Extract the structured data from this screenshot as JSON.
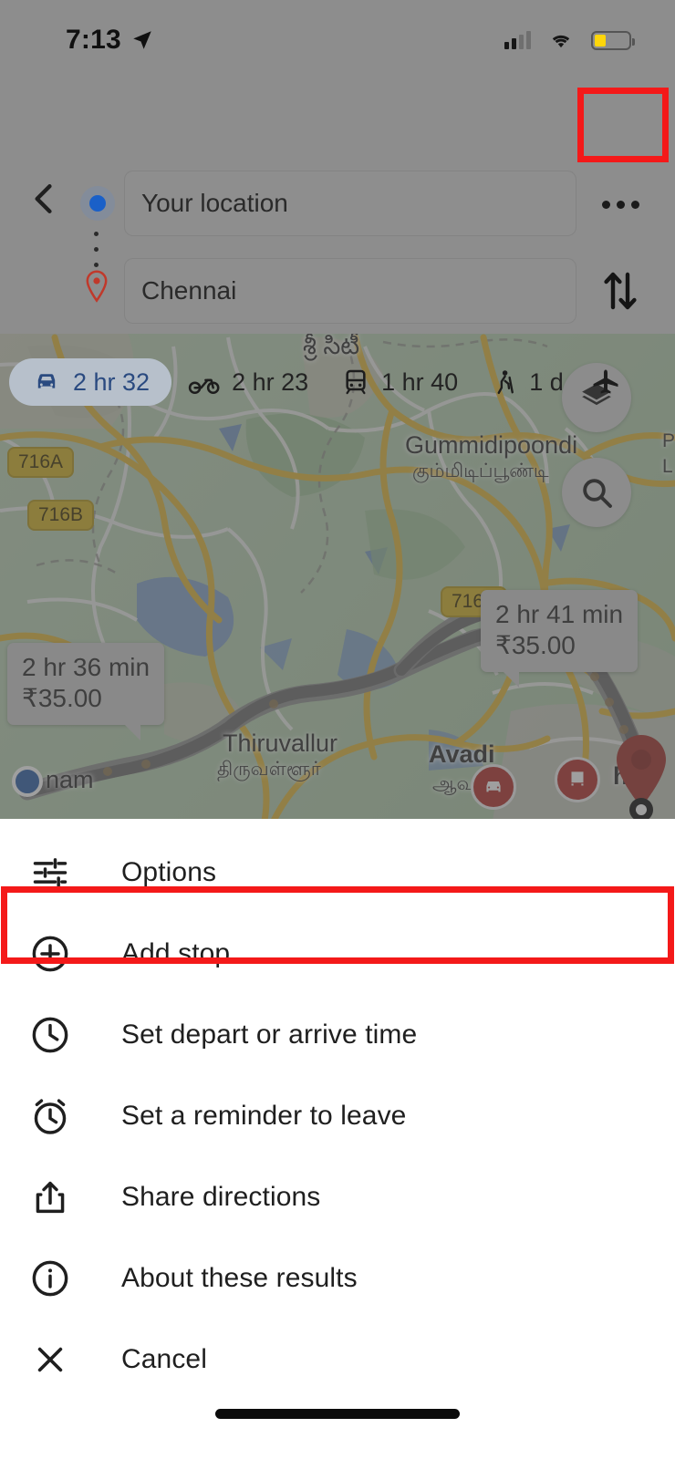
{
  "status_bar": {
    "time": "7:13",
    "location_arrow_icon": "navigation-arrow-icon",
    "signal_icon": "cellular-signal-icon",
    "wifi_icon": "wifi-icon",
    "battery_icon": "battery-low-icon",
    "battery_level_percent": 33
  },
  "header": {
    "back_icon": "back-chevron-icon",
    "origin_icon": "origin-dot-icon",
    "destination_icon": "destination-pin-icon",
    "origin_value": "Your location",
    "destination_value": "Chennai",
    "more_options_icon": "overflow-menu-icon",
    "swap_icon": "swap-vertical-icon",
    "highlight_color": "#f41919"
  },
  "travel_modes": [
    {
      "icon": "car-icon",
      "label": "2 hr 32",
      "selected": true
    },
    {
      "icon": "motorcycle-icon",
      "label": "2 hr 23",
      "selected": false
    },
    {
      "icon": "transit-icon",
      "label": "1 hr 40",
      "selected": false
    },
    {
      "icon": "walk-icon",
      "label": "1 d",
      "selected": false
    },
    {
      "icon": "flight-icon",
      "label": "",
      "selected": false
    }
  ],
  "map": {
    "layers_icon": "layers-icon",
    "search_icon": "search-icon",
    "place_labels": [
      {
        "name": "Sri City",
        "native": "శ్రీ సిటీ"
      },
      {
        "name": "Gummidipoondi",
        "native": "கும்மிடிப்பூண்டி"
      },
      {
        "name": "Thiruvallur",
        "native": "திருவள்ளூர்"
      },
      {
        "name": "Avadi",
        "native": "ஆவடி"
      },
      {
        "name": "nam",
        "native": ""
      },
      {
        "name": "he",
        "native": ""
      },
      {
        "name": "P",
        "native": "L"
      }
    ],
    "highway_shields": [
      "716A",
      "716B",
      "716A"
    ],
    "route_callouts": [
      {
        "duration": "2 hr 36 min",
        "toll": "₹35.00"
      },
      {
        "duration": "2 hr 41 min",
        "toll": "₹35.00"
      }
    ]
  },
  "bottom_sheet": {
    "items": [
      {
        "icon": "tune-sliders-icon",
        "label": "Options",
        "highlighted": false
      },
      {
        "icon": "add-circle-icon",
        "label": "Add stop",
        "highlighted": true
      },
      {
        "icon": "clock-icon",
        "label": "Set depart or arrive time",
        "highlighted": false
      },
      {
        "icon": "alarm-icon",
        "label": "Set a reminder to leave",
        "highlighted": false
      },
      {
        "icon": "share-icon",
        "label": "Share directions",
        "highlighted": false
      },
      {
        "icon": "info-icon",
        "label": "About these results",
        "highlighted": false
      },
      {
        "icon": "close-x-icon",
        "label": "Cancel",
        "highlighted": false
      }
    ],
    "highlight_color": "#f41919"
  }
}
